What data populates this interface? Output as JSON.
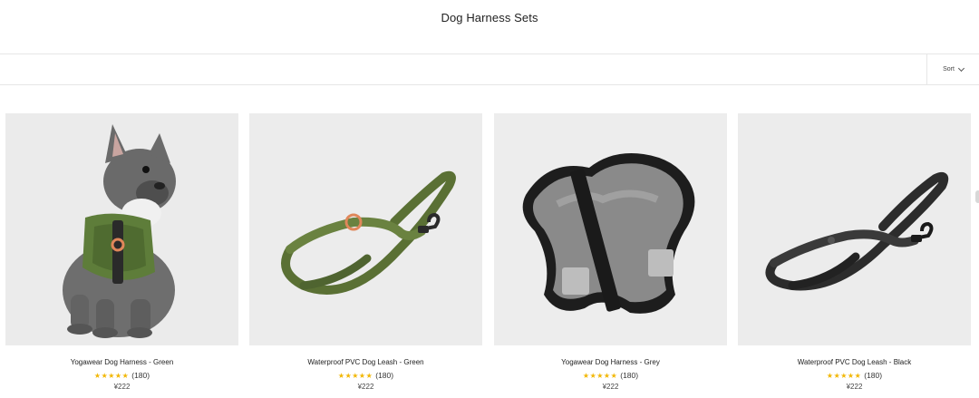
{
  "page": {
    "title": "Dog Harness Sets"
  },
  "toolbar": {
    "sort_label": "Sort"
  },
  "products": [
    {
      "name": "Yogawear Dog Harness - Green",
      "stars": "★★★★★",
      "reviews": "(180)",
      "price": "¥222",
      "image": "dog-wearing-green-harness"
    },
    {
      "name": "Waterproof PVC Dog Leash - Green",
      "stars": "★★★★★",
      "reviews": "(180)",
      "price": "¥222",
      "image": "green-leash"
    },
    {
      "name": "Yogawear Dog Harness - Grey",
      "stars": "★★★★★",
      "reviews": "(180)",
      "price": "¥222",
      "image": "grey-harness"
    },
    {
      "name": "Waterproof PVC Dog Leash - Black",
      "stars": "★★★★★",
      "reviews": "(180)",
      "price": "¥222",
      "image": "black-leash"
    }
  ],
  "colors": {
    "star": "#f2b705",
    "image_bg": "#eeeeee",
    "divider": "#e6e6e6"
  }
}
